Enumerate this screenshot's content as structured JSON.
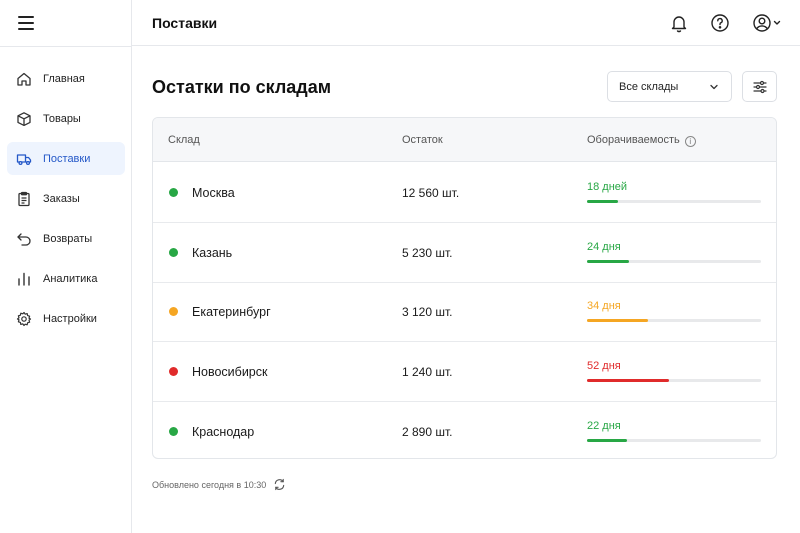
{
  "header": {
    "title": "Поставки"
  },
  "sidebar": {
    "items": [
      {
        "label": "Главная",
        "icon": "home-icon"
      },
      {
        "label": "Товары",
        "icon": "box-icon"
      },
      {
        "label": "Поставки",
        "icon": "truck-icon",
        "active": true
      },
      {
        "label": "Заказы",
        "icon": "clipboard-icon"
      },
      {
        "label": "Возвраты",
        "icon": "return-icon"
      },
      {
        "label": "Аналитика",
        "icon": "chart-icon"
      },
      {
        "label": "Настройки",
        "icon": "gear-icon"
      }
    ]
  },
  "main": {
    "title": "Остатки по складам",
    "warehouse_select": {
      "value": "Все склады"
    }
  },
  "table": {
    "columns": [
      "Склад",
      "Остаток",
      "Оборачиваемость"
    ],
    "rows": [
      {
        "city": "Москва",
        "stock": "12 560 шт.",
        "turnover": "18 дней",
        "turnover_fraction": 0.18,
        "status_color": "#28a745"
      },
      {
        "city": "Казань",
        "stock": "5 230 шт.",
        "turnover": "24 дня",
        "turnover_fraction": 0.24,
        "status_color": "#28a745"
      },
      {
        "city": "Екатеринбург",
        "stock": "3 120 шт.",
        "turnover": "34 дня",
        "turnover_fraction": 0.35,
        "status_color": "#f5a623"
      },
      {
        "city": "Новосибирск",
        "stock": "1 240 шт.",
        "turnover": "52 дня",
        "turnover_fraction": 0.47,
        "status_color": "#e02b2b"
      },
      {
        "city": "Краснодар",
        "stock": "2 890 шт.",
        "turnover": "22 дня",
        "turnover_fraction": 0.23,
        "status_color": "#28a745"
      }
    ]
  },
  "footer": {
    "updated": "Обновлено сегодня в 10:30"
  },
  "colors": {
    "accent": "#2458c8",
    "active_bg": "#eef4fe",
    "green": "#28a745",
    "orange": "#f5a623",
    "red": "#e02b2b"
  }
}
